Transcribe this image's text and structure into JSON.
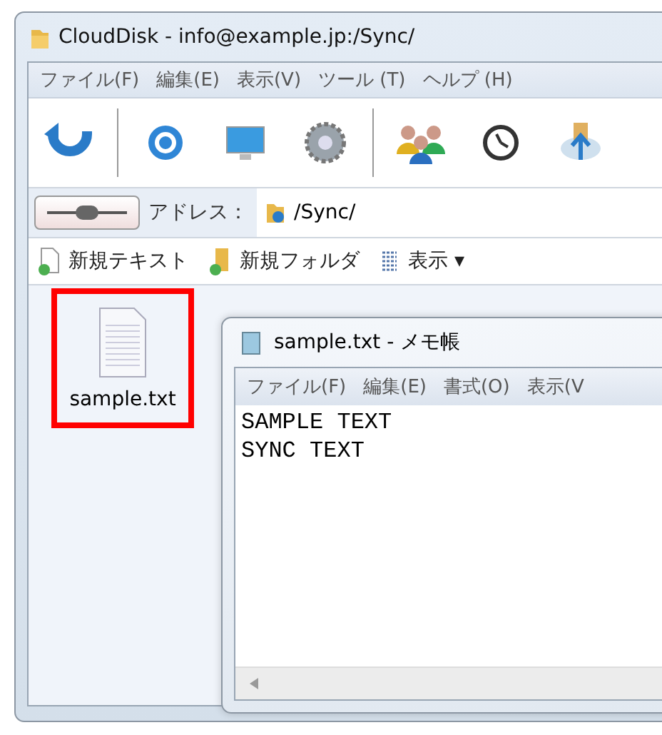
{
  "window": {
    "title": "CloudDisk - info@example.jp:/Sync/"
  },
  "menu": [
    "ファイル(F)",
    "編集(E)",
    "表示(V)",
    "ツール (T)",
    "ヘルプ (H)"
  ],
  "address": {
    "label": "アドレス：",
    "value": "/Sync/"
  },
  "actions": [
    {
      "kind": "text",
      "label": "新規テキスト"
    },
    {
      "kind": "folder",
      "label": "新規フォルダ"
    },
    {
      "kind": "view",
      "label": "表示 ▾"
    }
  ],
  "files": [
    {
      "name": "sample.txt",
      "highlighted": true
    }
  ],
  "notepad": {
    "title": "sample.txt - メモ帳",
    "menu": [
      "ファイル(F)",
      "編集(E)",
      "書式(O)",
      "表示(V"
    ],
    "lines": [
      "SAMPLE TEXT",
      "SYNC TEXT"
    ]
  }
}
